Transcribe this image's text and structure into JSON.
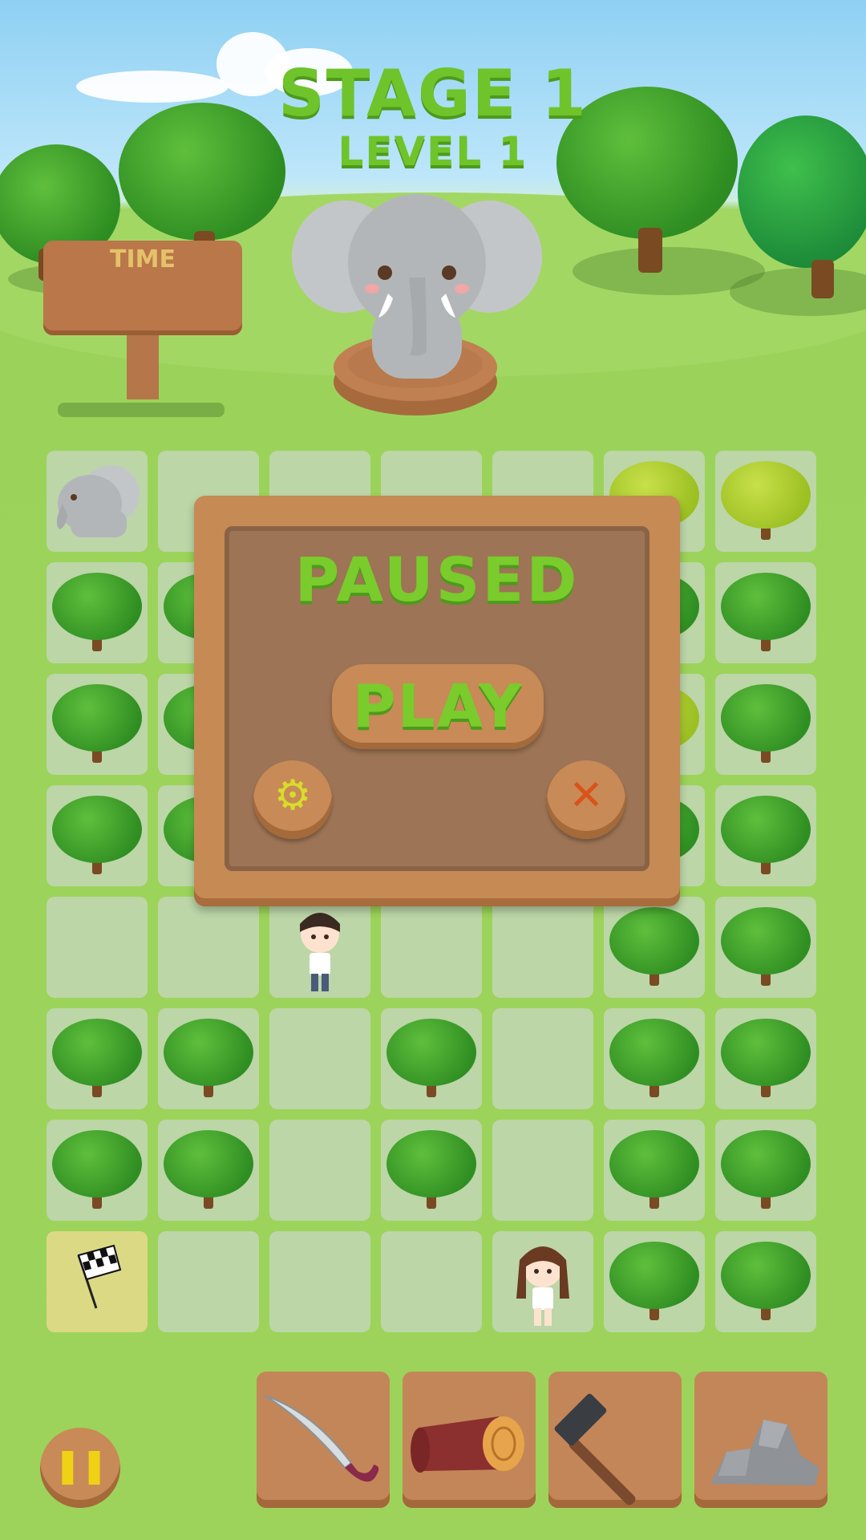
{
  "header": {
    "stage_title": "STAGE 1",
    "level_title": "LEVEL 1"
  },
  "timer_sign": {
    "label": "TIME"
  },
  "mascot": {
    "icon": "elephant-icon"
  },
  "board": {
    "rows": 8,
    "cols": 7,
    "start_icon": "elephant-icon",
    "goal_icon": "checkered-flag-icon",
    "player_icons": [
      "boy-character-icon",
      "girl-character-icon"
    ]
  },
  "pause_dialog": {
    "title": "PAUSED",
    "play_label": "PLAY",
    "settings_icon": "gear-icon",
    "close_icon": "close-icon"
  },
  "toolbar": {
    "pause_icon": "pause-icon",
    "tools": [
      {
        "name": "machete",
        "icon": "machete-icon"
      },
      {
        "name": "log",
        "icon": "log-icon"
      },
      {
        "name": "hammer",
        "icon": "hammer-icon"
      },
      {
        "name": "rocks",
        "icon": "rocks-icon"
      }
    ]
  },
  "colors": {
    "title_green": "#6ec42a",
    "wood": "#c68a55",
    "grass": "#9dd35a",
    "cell": "#bcd6a8",
    "goal_cell": "#dcd985",
    "gear_yellow": "#d7dc2a",
    "close_orange": "#d9541a"
  }
}
